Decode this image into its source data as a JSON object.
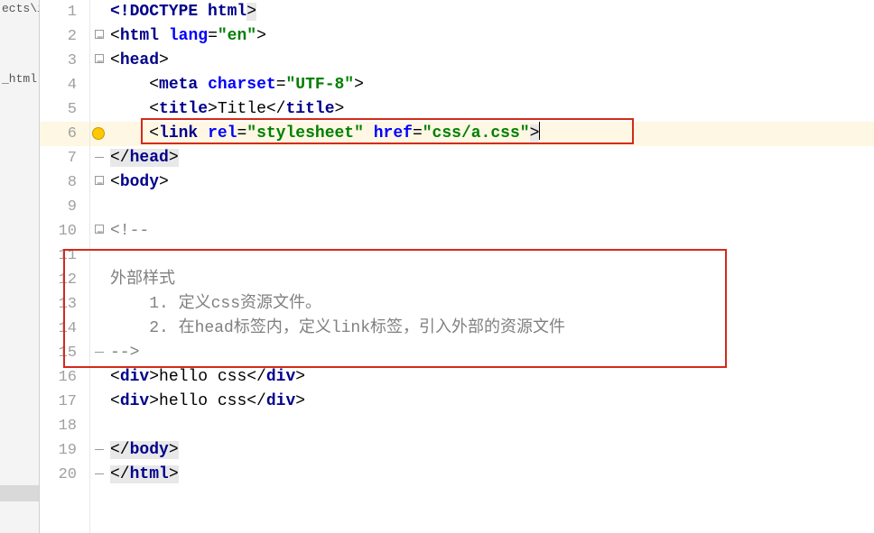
{
  "sidebar": {
    "tabs": [
      {
        "label": "ects\\i"
      },
      {
        "label": "_html"
      }
    ]
  },
  "code": {
    "lines": [
      {
        "n": 1
      },
      {
        "n": 2
      },
      {
        "n": 3
      },
      {
        "n": 4
      },
      {
        "n": 5
      },
      {
        "n": 6
      },
      {
        "n": 7
      },
      {
        "n": 8
      },
      {
        "n": 9
      },
      {
        "n": 10
      },
      {
        "n": 11
      },
      {
        "n": 12
      },
      {
        "n": 13
      },
      {
        "n": 14
      },
      {
        "n": 15
      },
      {
        "n": 16
      },
      {
        "n": 17
      },
      {
        "n": 18
      },
      {
        "n": 19
      },
      {
        "n": 20
      }
    ],
    "tokens": {
      "l1": {
        "doctype": "<!DOCTYPE ",
        "html": "html",
        "close": ">"
      },
      "l2": {
        "open": "<",
        "tag": "html",
        "sp": " ",
        "a1": "lang",
        "eq": "=",
        "v1": "\"en\"",
        "close": ">"
      },
      "l3": {
        "open": "<",
        "tag": "head",
        "close": ">"
      },
      "l4": {
        "open": "<",
        "tag": "meta",
        "sp": " ",
        "a1": "charset",
        "eq": "=",
        "v1": "\"UTF-8\"",
        "close": ">"
      },
      "l5": {
        "open": "<",
        "tag": "title",
        "close": ">",
        "text": "Title",
        "eopen": "</",
        "etag": "title",
        "eclose": ">"
      },
      "l6": {
        "open": "<",
        "tag": "link",
        "sp": " ",
        "a1": "rel",
        "eq": "=",
        "v1": "\"stylesheet\"",
        "sp2": " ",
        "a2": "href",
        "v2": "\"css/a.css\"",
        "close": ">"
      },
      "l7": {
        "open": "</",
        "tag": "head",
        "close": ">"
      },
      "l8": {
        "open": "<",
        "tag": "body",
        "close": ">"
      },
      "l10": {
        "text": "<!--"
      },
      "l12": {
        "text": "外部样式"
      },
      "l13": {
        "text": "    1. 定义css资源文件。"
      },
      "l14": {
        "text": "    2. 在head标签内，定义link标签，引入外部的资源文件"
      },
      "l15": {
        "text": "-->"
      },
      "l16": {
        "open": "<",
        "tag": "div",
        "close": ">",
        "text": "hello css",
        "eopen": "</",
        "etag": "div",
        "eclose": ">"
      },
      "l17": {
        "open": "<",
        "tag": "div",
        "close": ">",
        "text": "hello css",
        "eopen": "</",
        "etag": "div",
        "eclose": ">"
      },
      "l19": {
        "open": "</",
        "tag": "body",
        "close": ">"
      },
      "l20": {
        "open": "</",
        "tag": "html",
        "close": ">"
      }
    }
  }
}
